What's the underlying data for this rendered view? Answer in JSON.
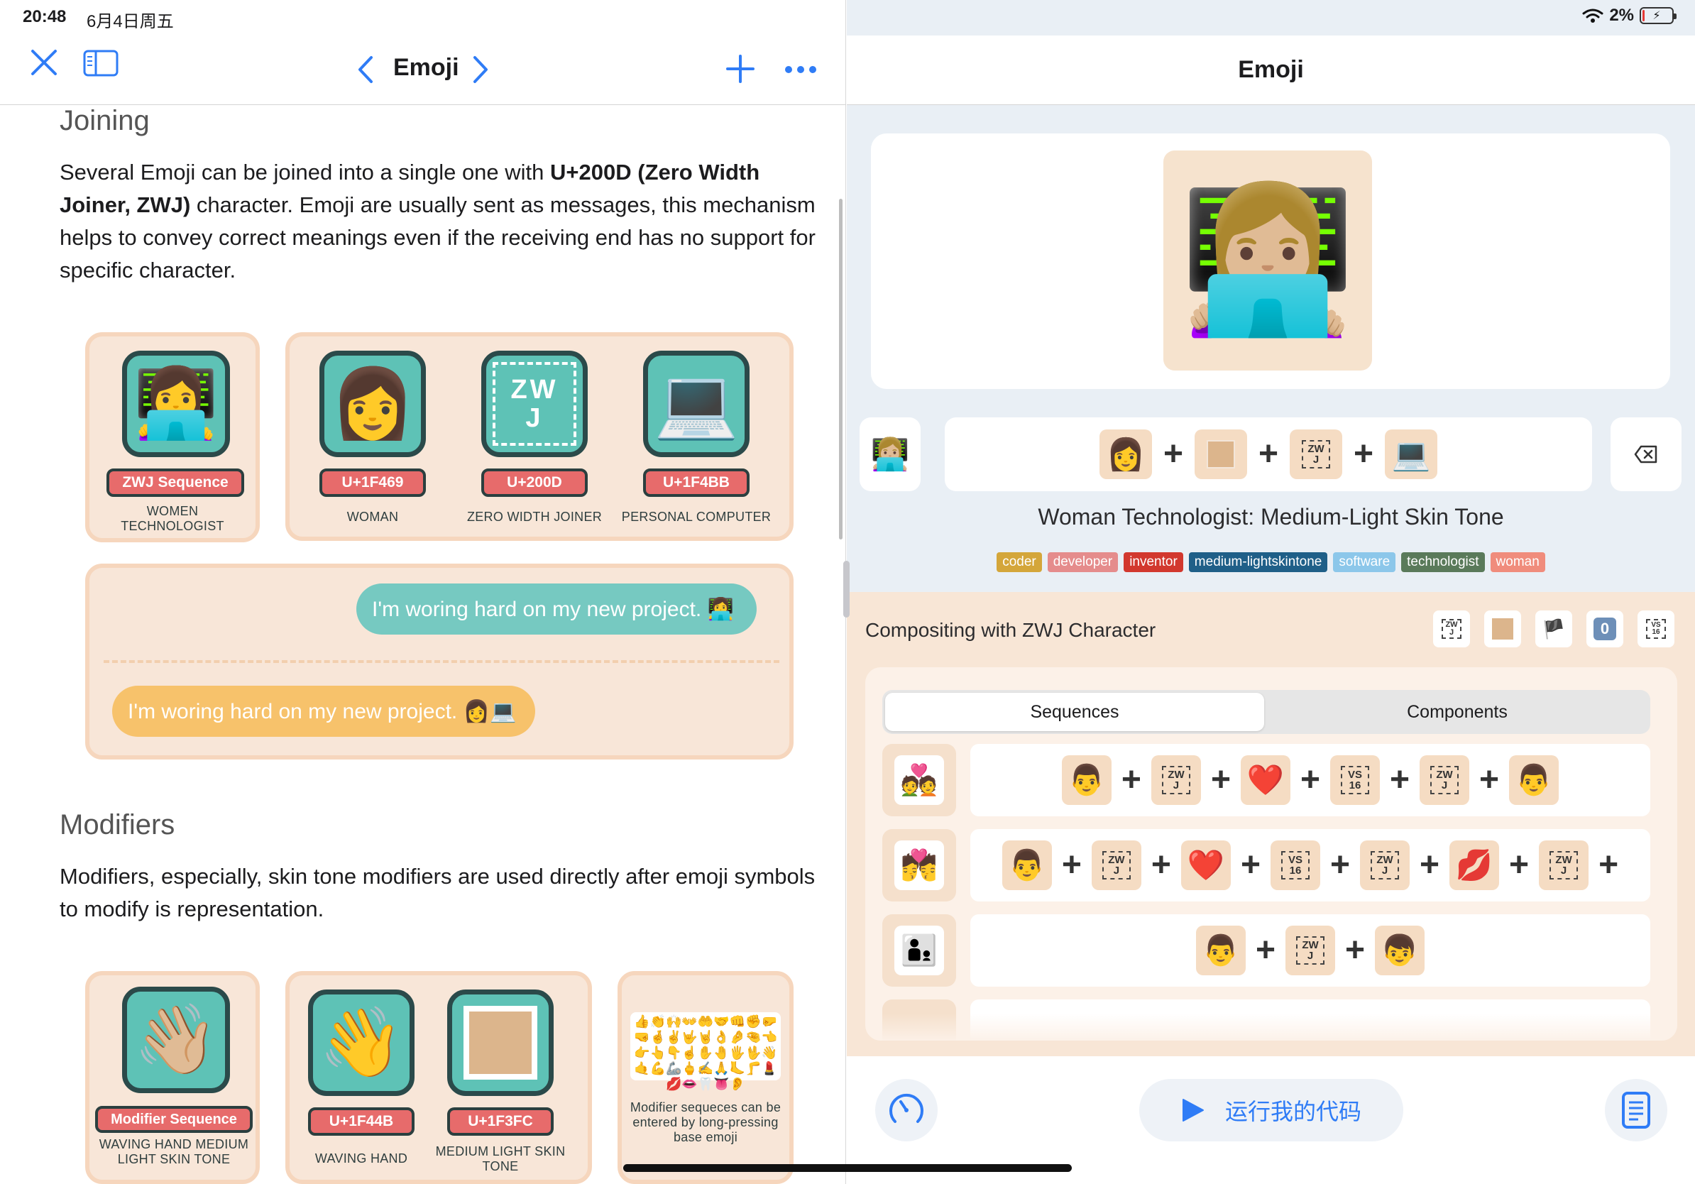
{
  "status": {
    "time": "20:48",
    "date": "6月4日周五",
    "battery": "2%"
  },
  "left": {
    "nav": {
      "title": "Emoji",
      "close_icon": "close-icon",
      "sidebar_icon": "sidebar-icon"
    },
    "joining": {
      "heading": "Joining",
      "p1": "Several Emoji can be joined into a single one with ",
      "p1_bold": "U+200D (Zero Width Joiner, ZWJ)",
      "p1_rest": " character. Emoji are usually sent as messages, this mechanism helps to convey correct meanings even if the receiving end has no support for specific character."
    },
    "zwj_card": {
      "seq_pill": "ZWJ Sequence",
      "seq_caption": "WOMEN TECHNOLOGIST",
      "items": [
        {
          "pill": "U+1F469",
          "caption": "WOMAN",
          "glyph": "👩"
        },
        {
          "pill": "U+200D",
          "caption": "ZERO WIDTH JOINER",
          "glyph": "ZW J"
        },
        {
          "pill": "U+1F4BB",
          "caption": "PERSONAL COMPUTER",
          "glyph": "💻"
        }
      ]
    },
    "chat": {
      "teal_msg": "I'm woring hard on my new project. 👩‍💻",
      "yellow_msg": "I'm woring hard on my new project. 👩💻"
    },
    "modifiers": {
      "heading": "Modifiers",
      "p": "Modifiers, especially, skin tone modifiers are used directly after emoji symbols to modify is representation."
    },
    "mod_card": {
      "seq_pill": "Modifier Sequence",
      "seq_caption": "WAVING HAND MEDIUM LIGHT SKIN TONE",
      "items": [
        {
          "pill": "U+1F44B",
          "caption": "WAVING HAND"
        },
        {
          "pill": "U+1F3FC",
          "caption": "MEDIUM LIGHT SKIN TONE"
        }
      ],
      "note": "Modifier sequeces can be entered by long-pressing base emoji"
    }
  },
  "right": {
    "nav": {
      "title": "Emoji"
    },
    "preview": {
      "glyph": "👩🏼‍💻"
    },
    "composer": {
      "parts": [
        "👩",
        "skin",
        "ZWJ",
        "💻"
      ],
      "name": "Woman Technologist: Medium-Light Skin Tone"
    },
    "tags": [
      {
        "label": "coder",
        "color": "#d4a63a"
      },
      {
        "label": "developer",
        "color": "#e58c8c"
      },
      {
        "label": "inventor",
        "color": "#d2382e"
      },
      {
        "label": "medium-lightskintone",
        "color": "#1f5f88"
      },
      {
        "label": "software",
        "color": "#8cc7ea"
      },
      {
        "label": "technologist",
        "color": "#5a7a5a"
      },
      {
        "label": "woman",
        "color": "#f08c7c"
      }
    ],
    "compositing": {
      "title": "Compositing with ZWJ Character",
      "seg_sequences": "Sequences",
      "seg_components": "Components",
      "rows": [
        {
          "icon": "💑",
          "parts": [
            "👨",
            "ZWJ",
            "❤️",
            "VS16",
            "ZWJ",
            "👨"
          ]
        },
        {
          "icon": "💏",
          "parts": [
            "👨",
            "ZWJ",
            "❤️",
            "VS16",
            "ZWJ",
            "💋",
            "ZWJ"
          ]
        },
        {
          "icon": "👨‍👦",
          "parts": [
            "👨",
            "ZWJ",
            "👦"
          ]
        }
      ]
    },
    "bottom": {
      "run_label": "运行我的代码"
    }
  }
}
